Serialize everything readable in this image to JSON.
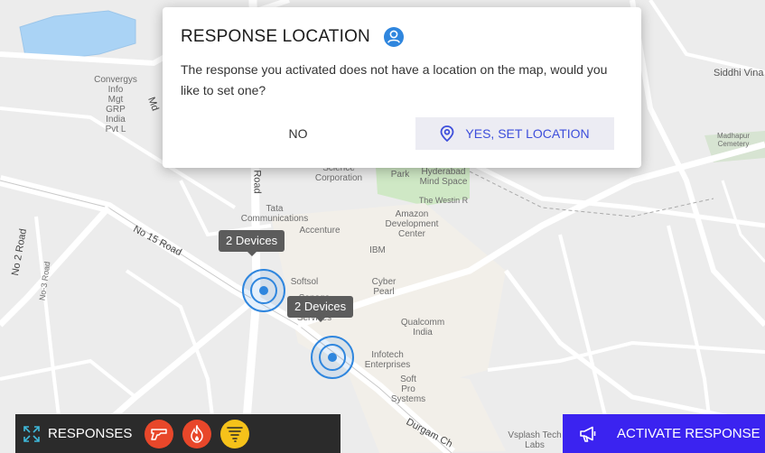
{
  "map": {
    "labels": [
      {
        "text": "Convergys\nInfo\nMgt\nGRP\nIndia\nPvt L"
      },
      {
        "text": "Madhapur\nCemetery"
      },
      {
        "text": "Siddhi Vina"
      },
      {
        "text": "Science\nCorporation"
      },
      {
        "text": "Park"
      },
      {
        "text": "Hyderabad\nMind Space"
      },
      {
        "text": "The Westin R"
      },
      {
        "text": "Tata\nCommunications"
      },
      {
        "text": "Amazon\nDevelopment\nCenter"
      },
      {
        "text": "Accenture"
      },
      {
        "text": "IBM"
      },
      {
        "text": "Softsol"
      },
      {
        "text": "Cyber\nPearl"
      },
      {
        "text": "Sanega\nGR\nServices"
      },
      {
        "text": "Qualcomm\nIndia"
      },
      {
        "text": "Infotech\nEnterprises"
      },
      {
        "text": "Soft\nPro\nSystems"
      },
      {
        "text": "Vsplash Tech\nLabs"
      },
      {
        "text": "No 15 Road"
      },
      {
        "text": "No 2 Road"
      },
      {
        "text": "No-3 Road"
      },
      {
        "text": "Road"
      },
      {
        "text": "Durgam Ch"
      },
      {
        "text": "Md"
      }
    ]
  },
  "clusters": [
    {
      "label": "2 Devices"
    },
    {
      "label": "2 Devices"
    }
  ],
  "dialog": {
    "title": "RESPONSE LOCATION",
    "title_icon": "user-circle-icon",
    "body": "The response you activated does not have a location on the map, would you like to set one?",
    "no_label": "NO",
    "yes_label": "YES, SET LOCATION",
    "yes_icon": "map-pin-icon"
  },
  "responses_bar": {
    "label": "RESPONSES",
    "expand_icon": "expand-icon",
    "icons": [
      "gun-icon",
      "fire-icon",
      "tornado-icon"
    ]
  },
  "activate": {
    "label": "ACTIVATE RESPONSE",
    "icon": "megaphone-icon"
  },
  "colors": {
    "accent": "#3b23f0",
    "link": "#3d4edb",
    "marker": "#2f86de",
    "incident_red": "#e8472a",
    "incident_yellow": "#f6c21a"
  }
}
